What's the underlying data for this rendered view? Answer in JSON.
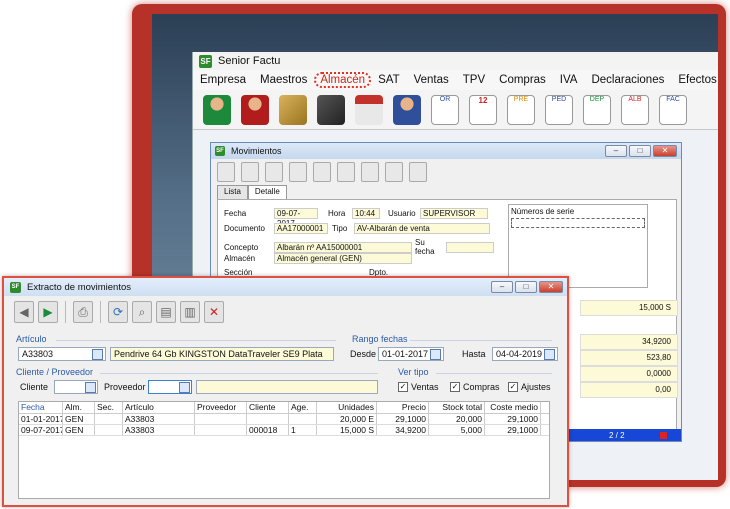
{
  "app": {
    "title": "Senior Factu",
    "logo": "SF"
  },
  "menu": [
    "Empresa",
    "Maestros",
    "Almacén",
    "SAT",
    "Ventas",
    "TPV",
    "Compras",
    "IVA",
    "Declaraciones",
    "Efectos"
  ],
  "menu_highlight_index": 2,
  "toolbar_icons": [
    "customer-icon",
    "supplier-icon",
    "boxes-icon",
    "hand-truck-icon",
    "shop-icon",
    "courier-icon",
    "order-doc-icon",
    "calendar-icon",
    "pre-doc-icon",
    "ped-doc-icon",
    "dep-doc-icon",
    "alb-doc-icon",
    "fac-doc-icon"
  ],
  "toolbar_doc_labels": {
    "or": "OR",
    "pre": "PRE",
    "ped": "PED",
    "dep": "DEP",
    "alb": "ALB",
    "fac": "FAC",
    "cal": "12"
  },
  "movimientos": {
    "title": "Movimientos",
    "tabs": [
      "Lista",
      "Detalle"
    ],
    "fields": {
      "fecha_label": "Fecha",
      "fecha": "09-07-2017",
      "hora_label": "Hora",
      "hora": "10:44",
      "usuario_label": "Usuario",
      "usuario": "SUPERVISOR",
      "documento_label": "Documento",
      "documento": "AA17000001",
      "tipo_label": "Tipo",
      "tipo": "AV-Albarán de venta",
      "concepto_label": "Concepto",
      "concepto": "Albarán nº AA15000001",
      "sufecha_label": "Su fecha",
      "almacen_label": "Almacén",
      "almacen": "Almacén general (GEN)",
      "seccion_label": "Sección",
      "dpto_label": "Dpto."
    },
    "numeros_serie_label": "Números de serie",
    "values": [
      "15,000 S",
      "34,9200",
      "523,80",
      "0,0000",
      "0,00"
    ],
    "status_page": "2 / 2"
  },
  "extracto": {
    "title": "Extracto de movimientos",
    "articulo_section": "Artículo",
    "articulo_code": "A33803",
    "articulo_desc": "Pendrive 64 Gb KINGSTON DataTraveler SE9 Plata",
    "rango_section": "Rango fechas",
    "desde_label": "Desde",
    "desde": "01-01-2017",
    "hasta_label": "Hasta",
    "hasta": "04-04-2019",
    "cliprov_section": "Cliente / Proveedor",
    "cliente_label": "Cliente",
    "cliente": "",
    "proveedor_label": "Proveedor",
    "proveedor": "",
    "vertipo_section": "Ver tipo",
    "ventas_label": "Ventas",
    "ventas": true,
    "compras_label": "Compras",
    "compras": true,
    "ajustes_label": "Ajustes",
    "ajustes": true,
    "columns": [
      "Fecha",
      "Alm.",
      "Sec.",
      "Artículo",
      "Proveedor",
      "Cliente",
      "Age.",
      "Unidades",
      "Precio",
      "Stock total",
      "Coste medio"
    ],
    "rows": [
      [
        "01-01-2017",
        "GEN",
        "",
        "A33803",
        "",
        "",
        "",
        "20,000 E",
        "29,1000",
        "20,000",
        "29,1000"
      ],
      [
        "09-07-2017",
        "GEN",
        "",
        "A33803",
        "",
        "000018",
        "1",
        "15,000 S",
        "34,9200",
        "5,000",
        "29,1000"
      ]
    ]
  },
  "colors": {
    "frame": "#b63228",
    "highlight": "#e2321f",
    "field_yellow": "#fdfbd7",
    "section_blue": "#2b5aa8"
  }
}
